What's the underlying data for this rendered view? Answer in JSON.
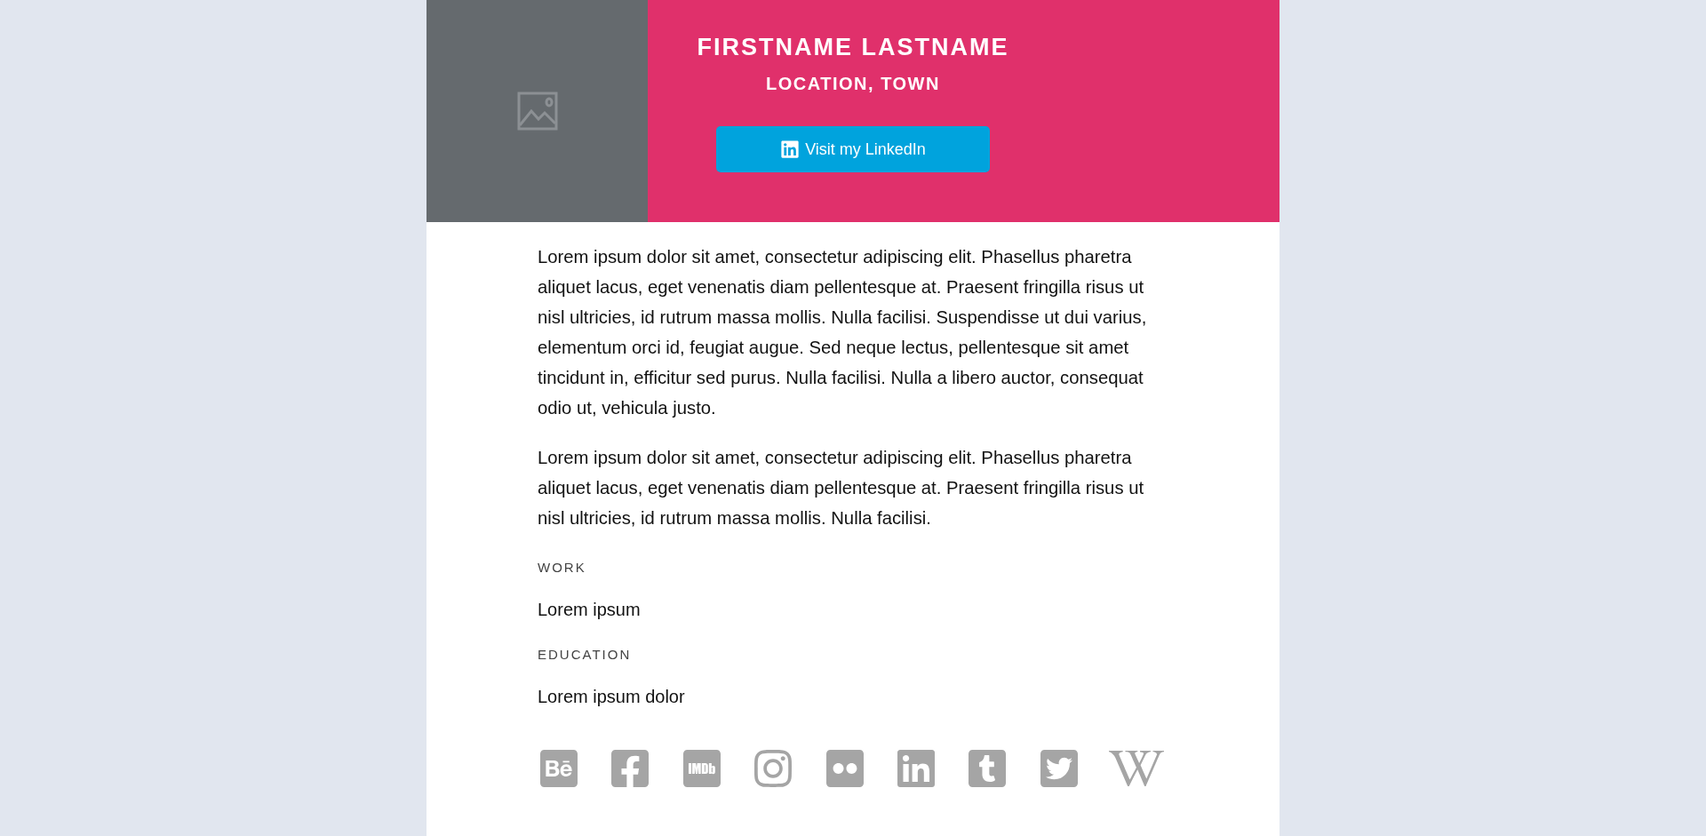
{
  "header": {
    "name": "FIRSTNAME LASTNAME",
    "location": "LOCATION, TOWN",
    "button": "Visit my LinkedIn"
  },
  "bio": [
    "Lorem ipsum dolor sit amet, consectetur adipiscing elit. Phasellus pharetra aliquet lacus, eget venenatis diam pellentesque at. Praesent fringilla risus ut nisl ultricies, id rutrum massa mollis. Nulla facilisi. Suspendisse ut dui varius, elementum orci id, feugiat augue. Sed neque lectus, pellentesque sit amet tincidunt in, efficitur sed purus. Nulla facilisi. Nulla a libero auctor, consequat odio ut, vehicula justo.",
    "Lorem ipsum dolor sit amet, consectetur adipiscing elit. Phasellus pharetra aliquet lacus, eget venenatis diam pellentesque at. Praesent fringilla risus ut nisl ultricies, id rutrum massa mollis. Nulla facilisi."
  ],
  "sections": [
    {
      "label": "WORK",
      "value": "Lorem ipsum"
    },
    {
      "label": "EDUCATION",
      "value": "Lorem ipsum dolor"
    }
  ],
  "social_links": [
    {
      "kind": "behance"
    },
    {
      "kind": "facebook"
    },
    {
      "kind": "imdb"
    },
    {
      "kind": "instagram"
    },
    {
      "kind": "flickr"
    },
    {
      "kind": "linkedin"
    },
    {
      "kind": "tumblr"
    },
    {
      "kind": "twitter"
    },
    {
      "kind": "wikipedia"
    }
  ]
}
